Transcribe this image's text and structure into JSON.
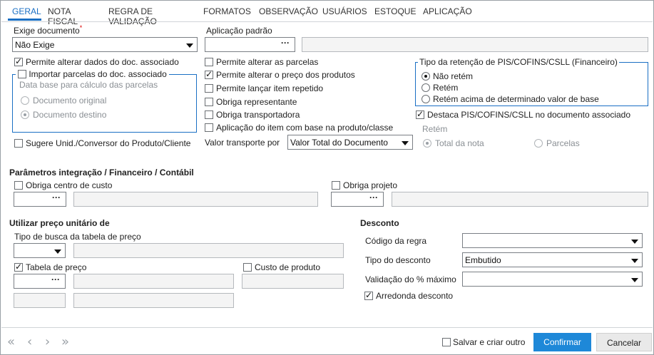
{
  "tabs": [
    "GERAL",
    "NOTA FISCAL",
    "REGRA DE VALIDAÇÃO",
    "FORMATOS",
    "OBSERVAÇÃO",
    "USUÁRIOS",
    "ESTOQUE",
    "APLICAÇÃO"
  ],
  "left": {
    "exige_documento_label": "Exige documento",
    "required_mark": "*",
    "exige_documento_value": "Não Exige",
    "permite_alterar_dados": "Permite alterar dados do doc. associado",
    "importar_parcelas": "Importar parcelas do doc. associado",
    "data_base_label": "Data base para cálculo das parcelas",
    "documento_original": "Documento original",
    "documento_destino": "Documento destino",
    "sugere_unid": "Sugere Unid./Conversor do Produto/Cliente"
  },
  "middle": {
    "aplicacao_padrao_label": "Aplicação padrão",
    "lookup_glyph": "···",
    "permite_alterar_parcelas": "Permite alterar as parcelas",
    "permite_alterar_preco": "Permite alterar o preço dos produtos",
    "permite_lancar_item": "Permite lançar item repetido",
    "obriga_representante": "Obriga representante",
    "obriga_transportadora": "Obriga transportadora",
    "aplicacao_item": "Aplicação do item com base na produto/classe",
    "valor_transporte_label": "Valor transporte por",
    "valor_transporte_value": "Valor Total do Documento"
  },
  "right": {
    "tipo_retencao_title": "Tipo da retenção de PIS/COFINS/CSLL (Financeiro)",
    "nao_retem": "Não retém",
    "retem": "Retém",
    "retem_acima": "Retém acima de determinado valor de base",
    "destaca_pis": "Destaca PIS/COFINS/CSLL no documento associado",
    "retem_label": "Retém",
    "total_da_nota": "Total da nota",
    "parcelas": "Parcelas"
  },
  "integracao": {
    "title": "Parâmetros integração / Financeiro / Contábil",
    "obriga_centro_custo": "Obriga centro de custo",
    "obriga_projeto": "Obriga projeto"
  },
  "preco": {
    "title": "Utilizar preço unitário de",
    "tipo_busca_label": "Tipo de busca da tabela de preço",
    "tabela_preco": "Tabela de preço",
    "custo_produto": "Custo de produto"
  },
  "desconto": {
    "title": "Desconto",
    "codigo_regra_label": "Código da regra",
    "tipo_desconto_label": "Tipo do desconto",
    "tipo_desconto_value": "Embutido",
    "validacao_label": "Validação do % máximo",
    "arredonda_desconto": "Arredonda desconto"
  },
  "footer": {
    "salvar_criar_outro": "Salvar e criar outro",
    "confirmar": "Confirmar",
    "cancelar": "Cancelar",
    "nav_first": "«",
    "nav_prev": "‹",
    "nav_next": "›",
    "nav_last": "»"
  },
  "colors": {
    "accent": "#1a6fc4",
    "confirm_bg": "#1e88d8",
    "cancel_bg": "#e9e9e9"
  },
  "state": {
    "permite_alterar_dados": true,
    "importar_parcelas": false,
    "data_base_selected": "documento_destino",
    "sugere_unid": false,
    "permite_alterar_parcelas": false,
    "permite_alterar_preco": true,
    "permite_lancar_item": false,
    "obriga_representante": false,
    "obriga_transportadora": false,
    "aplicacao_item": false,
    "tipo_retencao_selected": "nao_retem",
    "destaca_pis": true,
    "retem_selected": "total_da_nota",
    "obriga_centro_custo": false,
    "obriga_projeto": false,
    "tabela_preco": true,
    "custo_produto": false,
    "arredonda_desconto": true,
    "salvar_criar_outro": false
  }
}
